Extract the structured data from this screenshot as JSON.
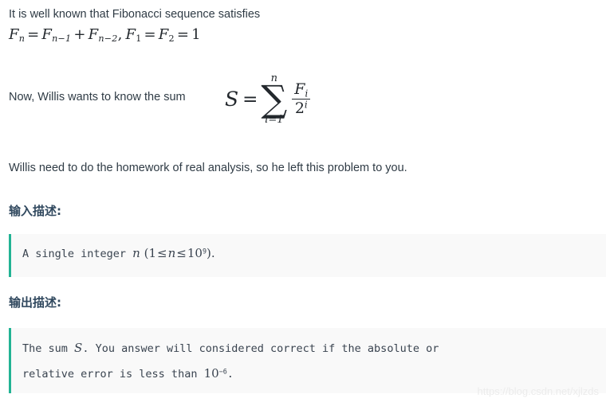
{
  "document": {
    "intro_text": "It is well known that Fibonacci sequence satisfies",
    "recurrence": {
      "f_n": "F",
      "sub_n": "n",
      "eq": "=",
      "f_n1": "F",
      "sub_n1": "n−1",
      "plus": "+",
      "f_n2": "F",
      "sub_n2": "n−2",
      "comma": ",",
      "f_1": "F",
      "sub_1": "1",
      "eq2": "=",
      "f_2": "F",
      "sub_2": "2",
      "eq3": "=",
      "one": "1"
    },
    "sum_lead_text": "Now, Willis wants to know the sum",
    "sum_formula": {
      "s": "S",
      "equals": "=",
      "sigma": "∑",
      "upper_limit": "n",
      "lower_limit": "i=1",
      "numerator_base": "F",
      "numerator_sub": "i",
      "denominator_base": "2",
      "denominator_sup": "i"
    },
    "closing_text": "Willis need to do the homework of real analysis, so he left this problem to you.",
    "sections": [
      {
        "heading": "输入描述:",
        "lines": [
          {
            "prefix": "A single integer ",
            "var": "n",
            "open_paren": " (1",
            "rel1": "≤",
            "var2": "n",
            "rel2": "≤",
            "power_base": "10",
            "power_exp": "9",
            "close": ").",
            "suffix": ""
          }
        ]
      },
      {
        "heading": "输出描述:",
        "lines": [
          {
            "prefix": "The sum ",
            "var": "S",
            "suffix": ". You answer will considered correct if the absolute or"
          },
          {
            "prefix": "relative error is less than ",
            "power_base": "10",
            "power_exp": "−6",
            "suffix": "."
          }
        ]
      }
    ],
    "watermark": "https://blog.csdn.net/xjlzds",
    "colors": {
      "body_text": "#2f3b45",
      "heading": "#31495f",
      "code_bg": "#f9f9f9",
      "code_accent": "#22b394",
      "math_text": "#23282d",
      "watermark": "#ececec"
    }
  }
}
